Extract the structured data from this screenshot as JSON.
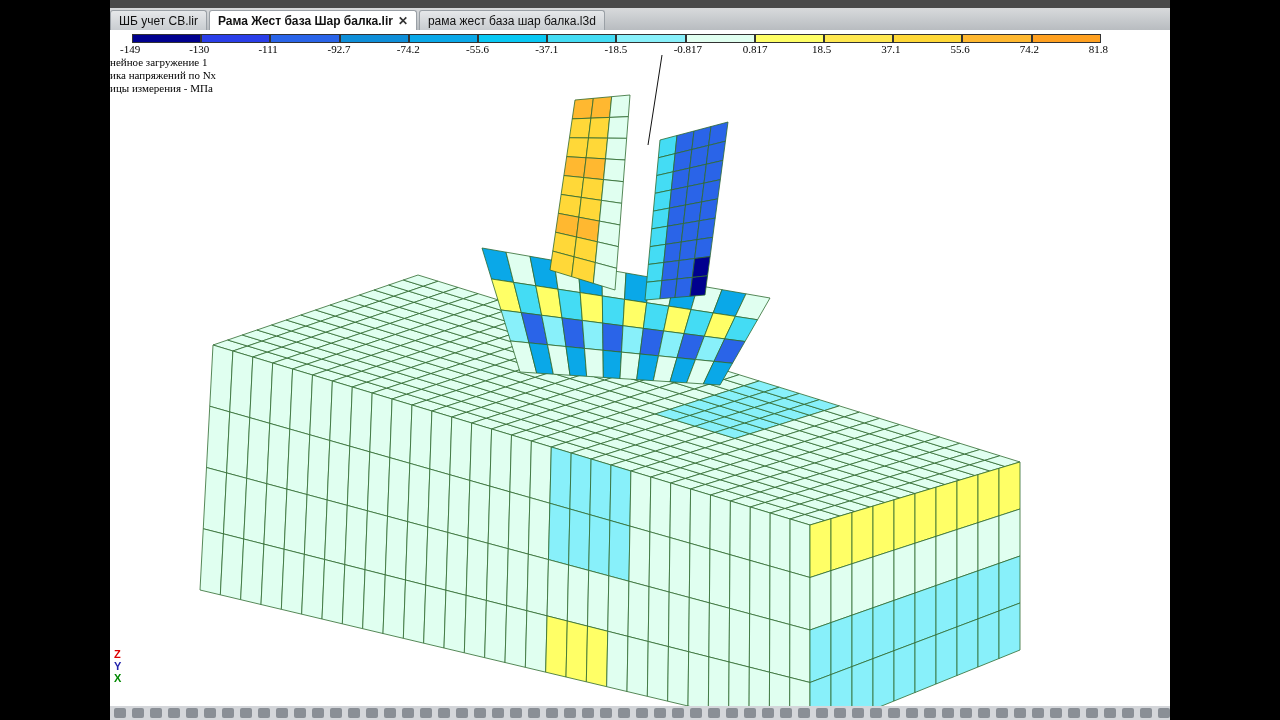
{
  "tabs": [
    {
      "label": "ШБ учет СВ.lir",
      "selected": false
    },
    {
      "label": "Рама Жест база Шар балка.lir",
      "selected": true,
      "close": "✕"
    },
    {
      "label": "рама жест база шар балка.l3d",
      "selected": false
    }
  ],
  "legend": [
    {
      "label": "-149",
      "color": "#00008e"
    },
    {
      "label": "-130",
      "color": "#2a3ee8"
    },
    {
      "label": "-111",
      "color": "#2a64e8"
    },
    {
      "label": "-92.7",
      "color": "#0e8ed8"
    },
    {
      "label": "-74.2",
      "color": "#0aa8e8"
    },
    {
      "label": "-55.6",
      "color": "#08c8f4"
    },
    {
      "label": "-37.1",
      "color": "#44dcf4"
    },
    {
      "label": "-18.5",
      "color": "#88f0fa"
    },
    {
      "label": "-0.817",
      "color": "#e0fff0"
    },
    {
      "label": "0.817",
      "color": "#ffff66"
    },
    {
      "label": "18.5",
      "color": "#ffe850"
    },
    {
      "label": "37.1",
      "color": "#ffd838"
    },
    {
      "label": "55.6",
      "color": "#ffb830"
    },
    {
      "label": "74.2",
      "color": "#ffa020"
    },
    {
      "label": "81.8"
    }
  ],
  "info_lines": [
    "нейное загружение 1",
    "ика напряжений по Nx",
    "ицы измерения - МПа"
  ],
  "axes": {
    "z": "Z",
    "y": "Y",
    "x": "X"
  }
}
